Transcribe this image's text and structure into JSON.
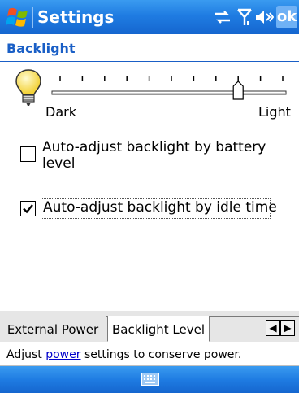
{
  "titlebar": {
    "title": "Settings",
    "ok_label": "ok",
    "status_icons": [
      "connectivity-icon",
      "signal-antenna-icon",
      "speaker-icon"
    ]
  },
  "section": {
    "title": "Backlight"
  },
  "slider": {
    "min_label": "Dark",
    "max_label": "Light",
    "ticks": 11,
    "value": 8,
    "max": 10
  },
  "options": [
    {
      "line1": "Auto-adjust backlight by battery",
      "line2": "level",
      "checked": false
    },
    {
      "label": "Auto-adjust backlight by idle time",
      "checked": true
    }
  ],
  "tabs": [
    {
      "label": "External Power",
      "active": false
    },
    {
      "label": "Backlight Level",
      "active": true
    }
  ],
  "footer": {
    "prefix": "Adjust ",
    "link": "power",
    "suffix": " settings to conserve power."
  },
  "menubar": {
    "icon": "keyboard-icon"
  },
  "colors": {
    "accent": "#1a5fc6",
    "titlebar": "#1f7ce2",
    "link": "#0000cc"
  }
}
